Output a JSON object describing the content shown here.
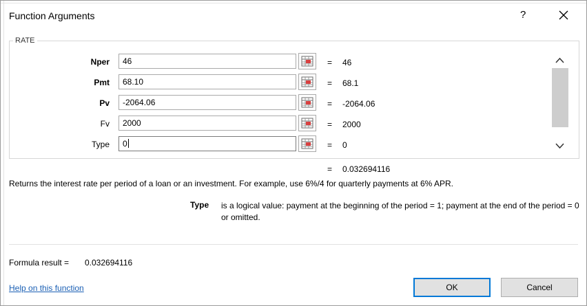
{
  "dialog": {
    "title": "Function Arguments",
    "help_glyph": "?",
    "close_glyph": "✕"
  },
  "function_name": "RATE",
  "arguments": [
    {
      "label": "Nper",
      "bold": true,
      "value": "46",
      "evaluated": "46"
    },
    {
      "label": "Pmt",
      "bold": true,
      "value": "68.10",
      "evaluated": "68.1"
    },
    {
      "label": "Pv",
      "bold": true,
      "value": "-2064.06",
      "evaluated": "-2064.06"
    },
    {
      "label": "Fv",
      "bold": false,
      "value": "2000",
      "evaluated": "2000"
    },
    {
      "label": "Type",
      "bold": false,
      "value": "0",
      "evaluated": "0"
    }
  ],
  "equals_sign": "=",
  "result_preview": "0.032694116",
  "description": "Returns the interest rate per period of a loan or an investment. For example, use 6%/4 for quarterly payments at 6% APR.",
  "param_help": {
    "name": "Type",
    "text": "is a logical value: payment at the beginning of the period = 1; payment at the end of the period = 0 or omitted."
  },
  "formula_result": {
    "label": "Formula result =",
    "value": "0.032694116"
  },
  "help_link": "Help on this function",
  "buttons": {
    "ok": "OK",
    "cancel": "Cancel"
  },
  "icons": {
    "ref": "collapse-dialog-icon",
    "scroll_up": "chevron-up-icon",
    "scroll_down": "chevron-down-icon"
  },
  "colors": {
    "accent": "#0078d7",
    "link": "#1a5fb4",
    "button_face": "#e1e1e1"
  }
}
